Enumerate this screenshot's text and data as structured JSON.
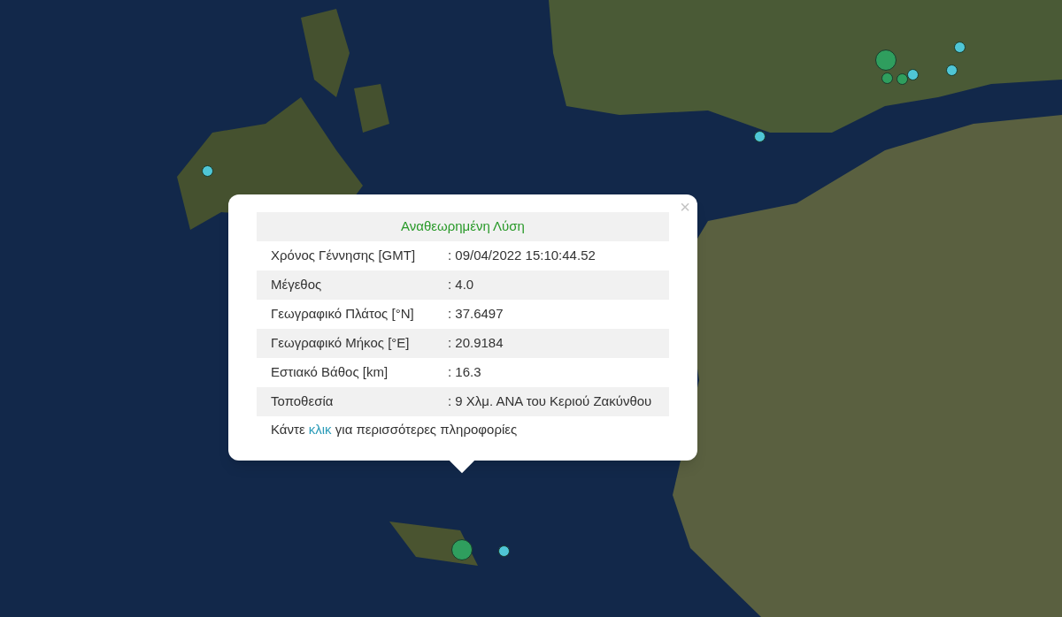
{
  "markers": [
    {
      "kind": "large",
      "color": "#2f9e5e"
    },
    {
      "kind": "small",
      "color": "#2f9e5e"
    },
    {
      "kind": "small",
      "color": "#2f9e5e"
    },
    {
      "kind": "small",
      "color": "#4fc6d6"
    },
    {
      "kind": "small",
      "color": "#4fc6d6"
    },
    {
      "kind": "small",
      "color": "#4fc6d6"
    },
    {
      "kind": "small",
      "color": "#4fc6d6"
    },
    {
      "kind": "small",
      "color": "#4fc6d6"
    },
    {
      "kind": "large",
      "color": "#2f9e5e"
    },
    {
      "kind": "small",
      "color": "#4fc6d6"
    }
  ],
  "popup": {
    "close": "×",
    "title": "Αναθεωρημένη Λύση",
    "rows": [
      {
        "label": "Χρόνος Γέννησης [GMT]",
        "value": ": 09/04/2022 15:10:44.52"
      },
      {
        "label": "Μέγεθος",
        "value": ": 4.0"
      },
      {
        "label": "Γεωγραφικό Πλάτος [°N]",
        "value": ": 37.6497"
      },
      {
        "label": "Γεωγραφικό Μήκος [°E]",
        "value": ": 20.9184"
      },
      {
        "label": "Εστιακό Βάθος [km]",
        "value": ": 16.3"
      },
      {
        "label": "Τοποθεσία",
        "value": ": 9 Χλμ. ΑΝΑ του Κεριού Ζακύνθου"
      }
    ],
    "footer": {
      "before": "Κάντε",
      "link": "κλικ",
      "after": "για περισσότερες πληροφορίες"
    }
  }
}
